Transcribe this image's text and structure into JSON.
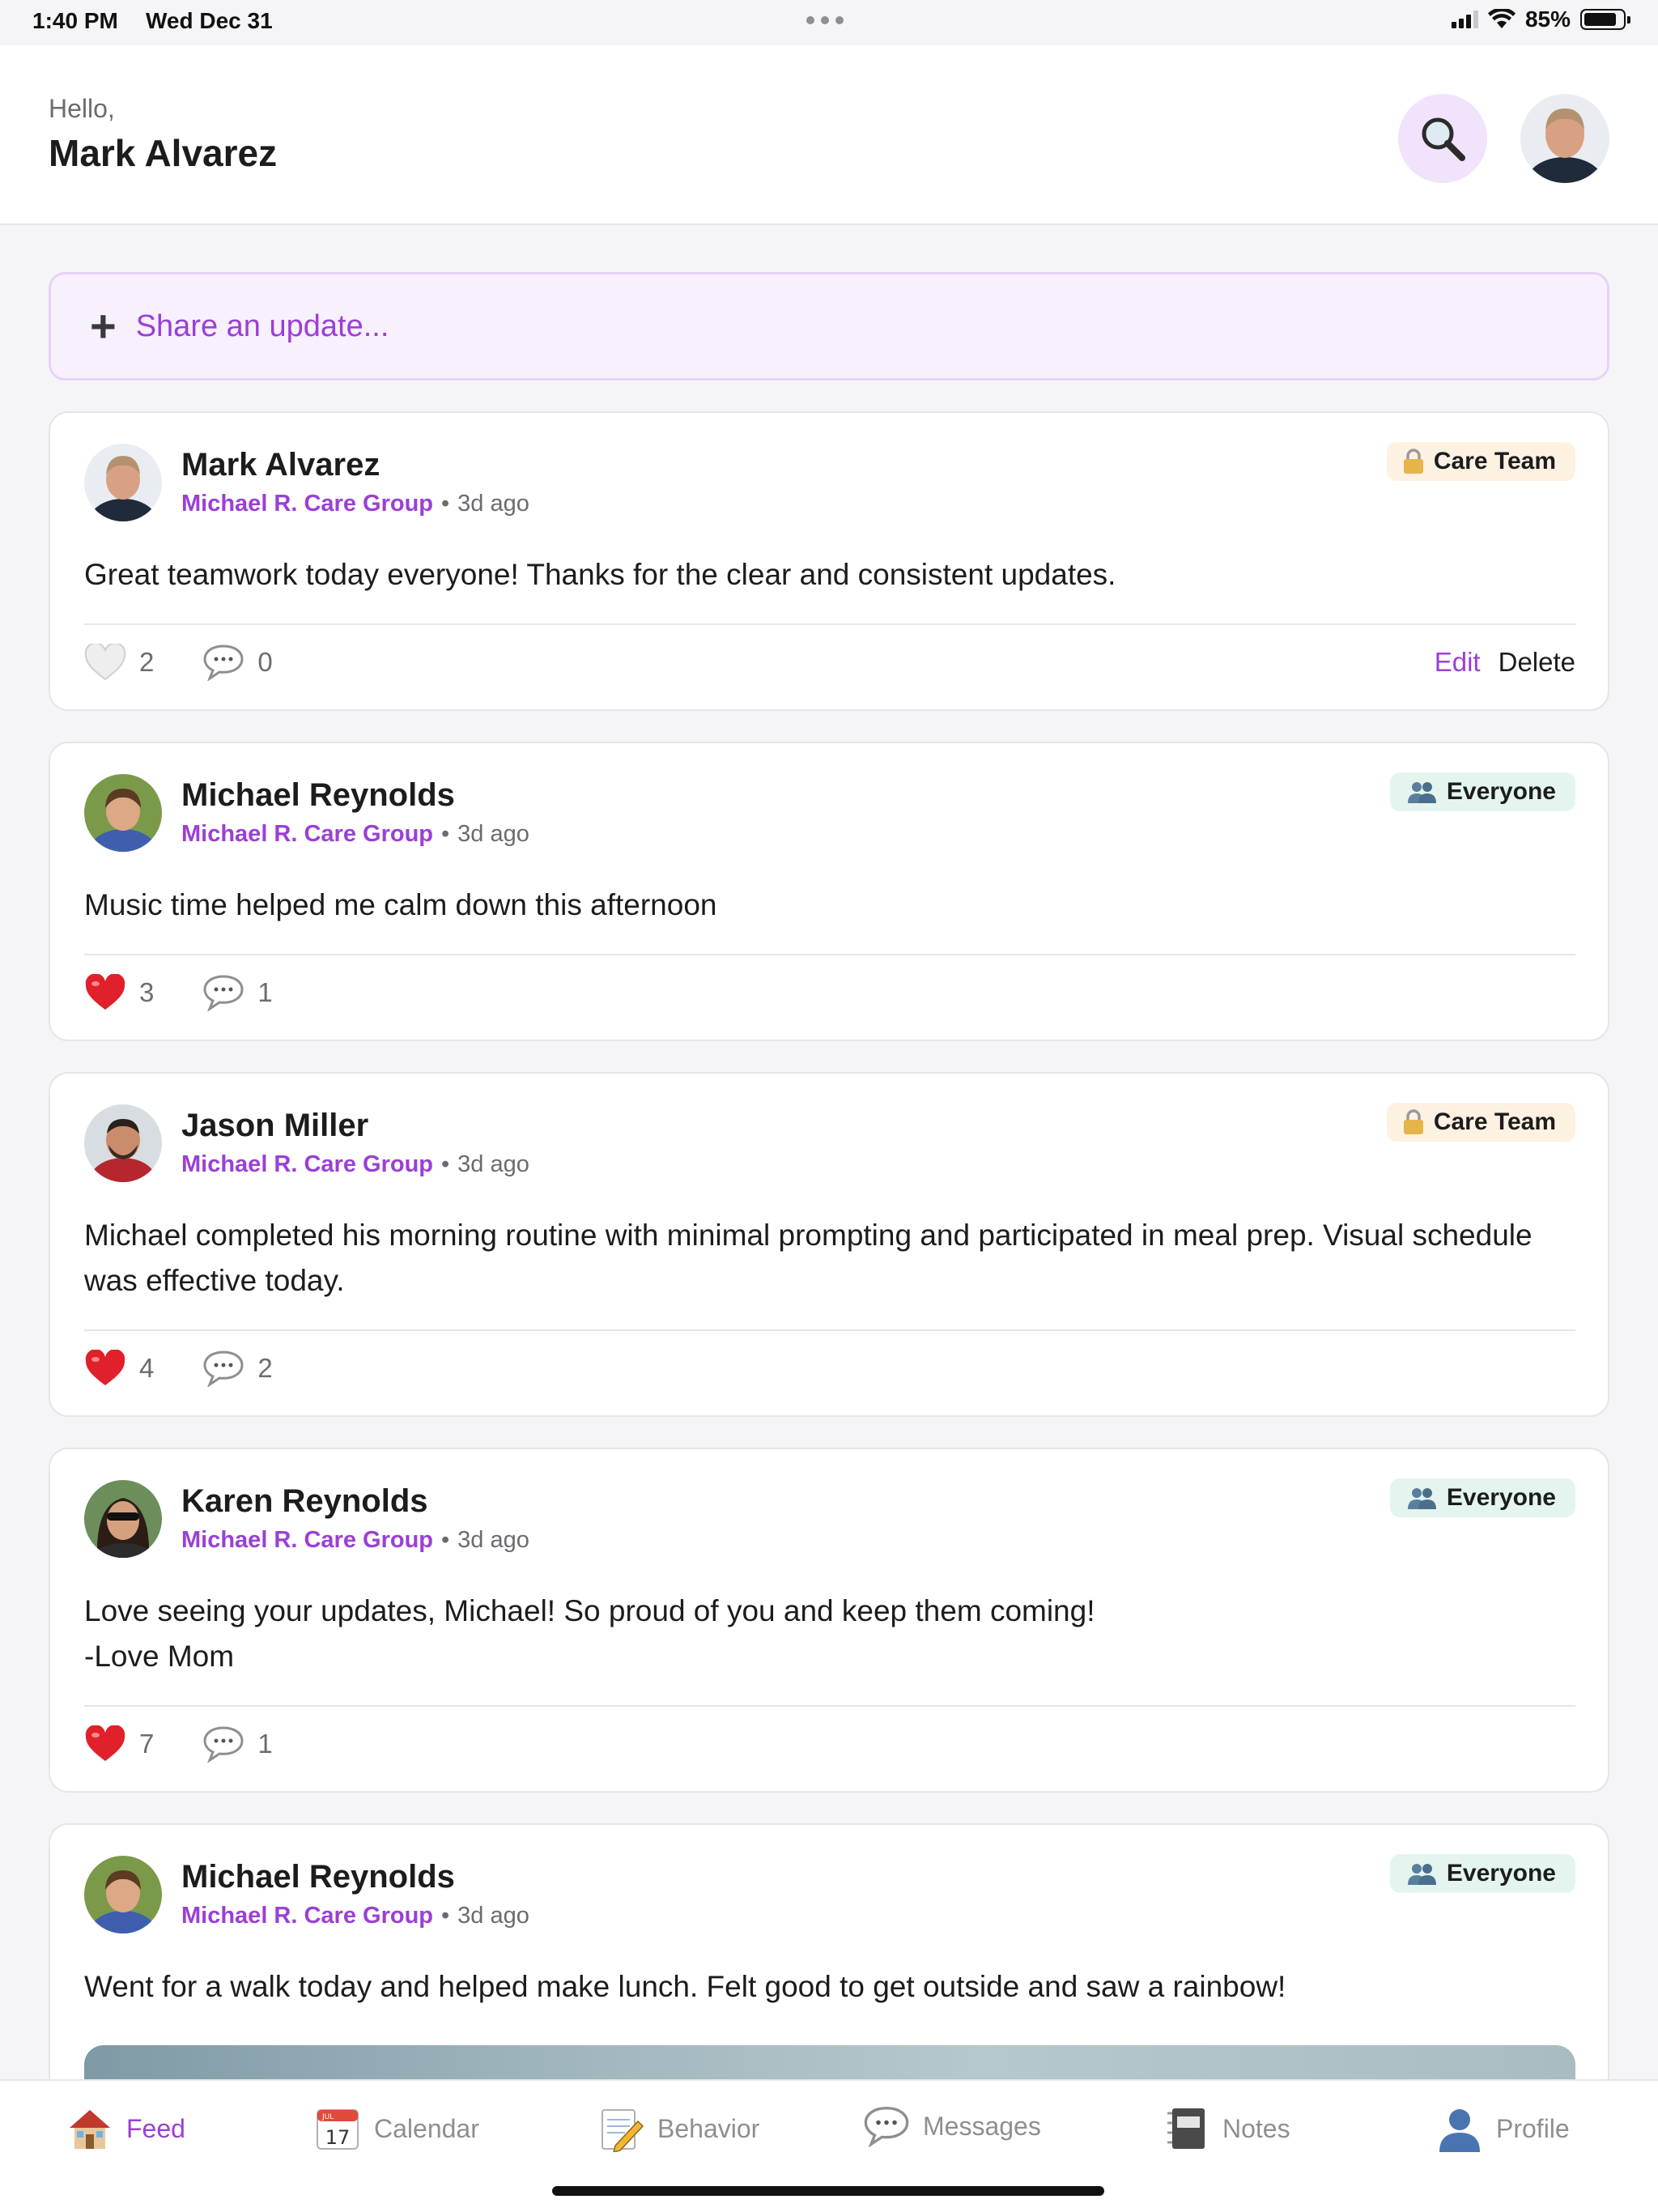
{
  "status_bar": {
    "time": "1:40 PM",
    "date": "Wed Dec 31",
    "battery": "85%",
    "battery_level": 0.85
  },
  "header": {
    "greeting": "Hello,",
    "user_name": "Mark Alvarez"
  },
  "composer": {
    "placeholder": "Share an update..."
  },
  "posts": [
    {
      "author": "Mark Alvarez",
      "group": "Michael R. Care Group",
      "separator": "•",
      "time": "3d ago",
      "audience": "Care Team",
      "text": "Great teamwork today everyone! Thanks for the clear and consistent updates.",
      "likes": "2",
      "comments": "0",
      "liked": false,
      "edit_label": "Edit",
      "delete_label": "Delete"
    },
    {
      "author": "Michael Reynolds",
      "group": "Michael R. Care Group",
      "separator": "•",
      "time": "3d ago",
      "audience": "Everyone",
      "text": "Music time helped me calm down this afternoon",
      "likes": "3",
      "comments": "1",
      "liked": true
    },
    {
      "author": "Jason Miller",
      "group": "Michael R. Care Group",
      "separator": "•",
      "time": "3d ago",
      "audience": "Care Team",
      "text": "Michael completed his morning routine with minimal prompting and participated in meal prep. Visual schedule was effective today.",
      "likes": "4",
      "comments": "2",
      "liked": true
    },
    {
      "author": "Karen Reynolds",
      "group": "Michael R. Care Group",
      "separator": "•",
      "time": "3d ago",
      "audience": "Everyone",
      "text_line1": "Love seeing your updates, Michael! So proud of you and keep them coming!",
      "text_line2": "-Love Mom",
      "likes": "7",
      "comments": "1",
      "liked": true
    },
    {
      "author": "Michael Reynolds",
      "group": "Michael R. Care Group",
      "separator": "•",
      "time": "3d ago",
      "audience": "Everyone",
      "text": "Went for a walk today and helped make lunch. Felt good to get outside and saw a rainbow!"
    }
  ],
  "tabs": [
    {
      "label": "Feed",
      "icon": "house-icon",
      "active": true
    },
    {
      "label": "Calendar",
      "icon": "calendar-icon",
      "calendar_month": "JUL",
      "calendar_day": "17"
    },
    {
      "label": "Behavior",
      "icon": "memo-icon"
    },
    {
      "label": "Messages",
      "icon": "speech-bubble-icon"
    },
    {
      "label": "Notes",
      "icon": "notebook-icon"
    },
    {
      "label": "Profile",
      "icon": "person-icon"
    }
  ],
  "colors": {
    "accent": "#9b3fd6",
    "care_badge": "#fdf1e2",
    "everyone_badge": "#e4f5ef",
    "heart": "#e0202a"
  }
}
